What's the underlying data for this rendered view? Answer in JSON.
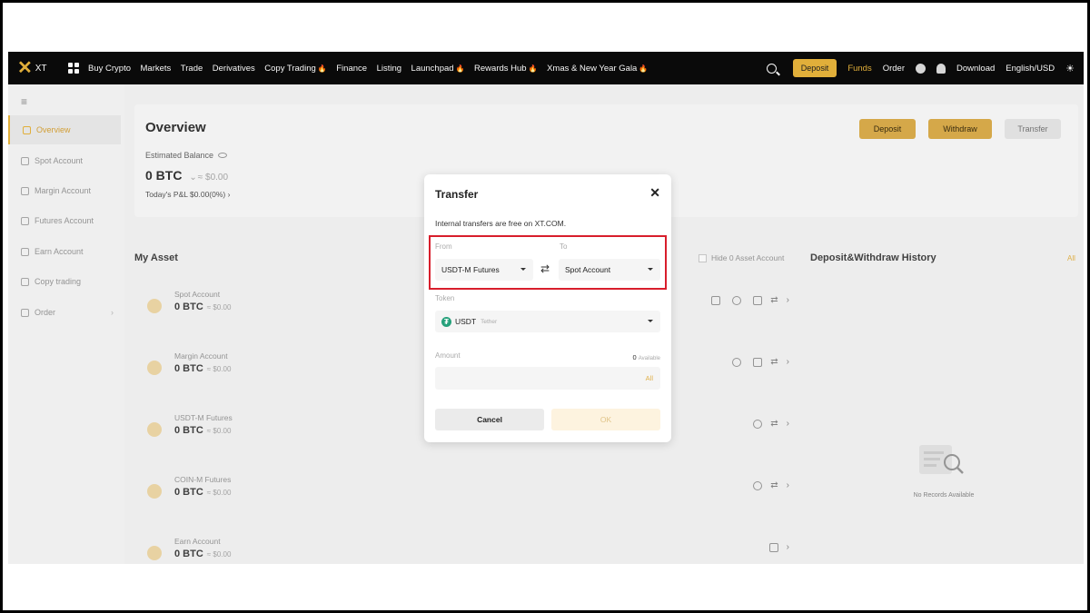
{
  "nav": {
    "logo": "XT",
    "items": [
      {
        "label": "Buy Crypto",
        "hot": false
      },
      {
        "label": "Markets",
        "hot": false
      },
      {
        "label": "Trade",
        "hot": false
      },
      {
        "label": "Derivatives",
        "hot": false
      },
      {
        "label": "Copy Trading",
        "hot": true
      },
      {
        "label": "Finance",
        "hot": false
      },
      {
        "label": "Listing",
        "hot": false
      },
      {
        "label": "Launchpad",
        "hot": true
      },
      {
        "label": "Rewards Hub",
        "hot": true
      },
      {
        "label": "Xmas & New Year Gala",
        "hot": true
      }
    ],
    "deposit": "Deposit",
    "funds": "Funds",
    "order": "Order",
    "download": "Download",
    "language": "English/USD"
  },
  "sidebar": {
    "items": [
      {
        "label": "Overview",
        "active": true
      },
      {
        "label": "Spot Account"
      },
      {
        "label": "Margin Account"
      },
      {
        "label": "Futures Account"
      },
      {
        "label": "Earn Account"
      },
      {
        "label": "Copy trading"
      },
      {
        "label": "Order"
      }
    ]
  },
  "overview": {
    "title": "Overview",
    "estimated_label": "Estimated Balance",
    "balance": "0 BTC",
    "balance_usd": "≈ $0.00",
    "pnl": "Today's P&L  $0.00(0%)",
    "deposit": "Deposit",
    "withdraw": "Withdraw",
    "transfer": "Transfer"
  },
  "assets": {
    "title": "My Asset",
    "hide_zero": "Hide 0 Asset Account",
    "rows": [
      {
        "name": "Spot Account",
        "value": "0 BTC",
        "usd": "≈ $0.00"
      },
      {
        "name": "Margin Account",
        "value": "0 BTC",
        "usd": "≈ $0.00"
      },
      {
        "name": "USDT-M Futures",
        "value": "0 BTC",
        "usd": "≈ $0.00"
      },
      {
        "name": "COIN-M Futures",
        "value": "0 BTC",
        "usd": "≈ $0.00"
      },
      {
        "name": "Earn Account",
        "value": "0 BTC",
        "usd": "≈ $0.00"
      }
    ]
  },
  "history": {
    "title": "Deposit&Withdraw History",
    "all": "All",
    "empty": "No Records Available"
  },
  "modal": {
    "title": "Transfer",
    "close": "✕",
    "note": "Internal transfers are free on XT.COM.",
    "from_label": "From",
    "from_value": "USDT-M Futures",
    "to_label": "To",
    "to_value": "Spot Account",
    "token_label": "Token",
    "token_symbol": "USDT",
    "token_name": "Tether",
    "amount_label": "Amount",
    "available_amount": "0",
    "available_label": "Available",
    "all": "All",
    "cancel": "Cancel",
    "ok": "OK"
  },
  "colors": {
    "accent": "#e9b53c",
    "highlight": "#d81e2c",
    "usdt": "#26a17b"
  }
}
